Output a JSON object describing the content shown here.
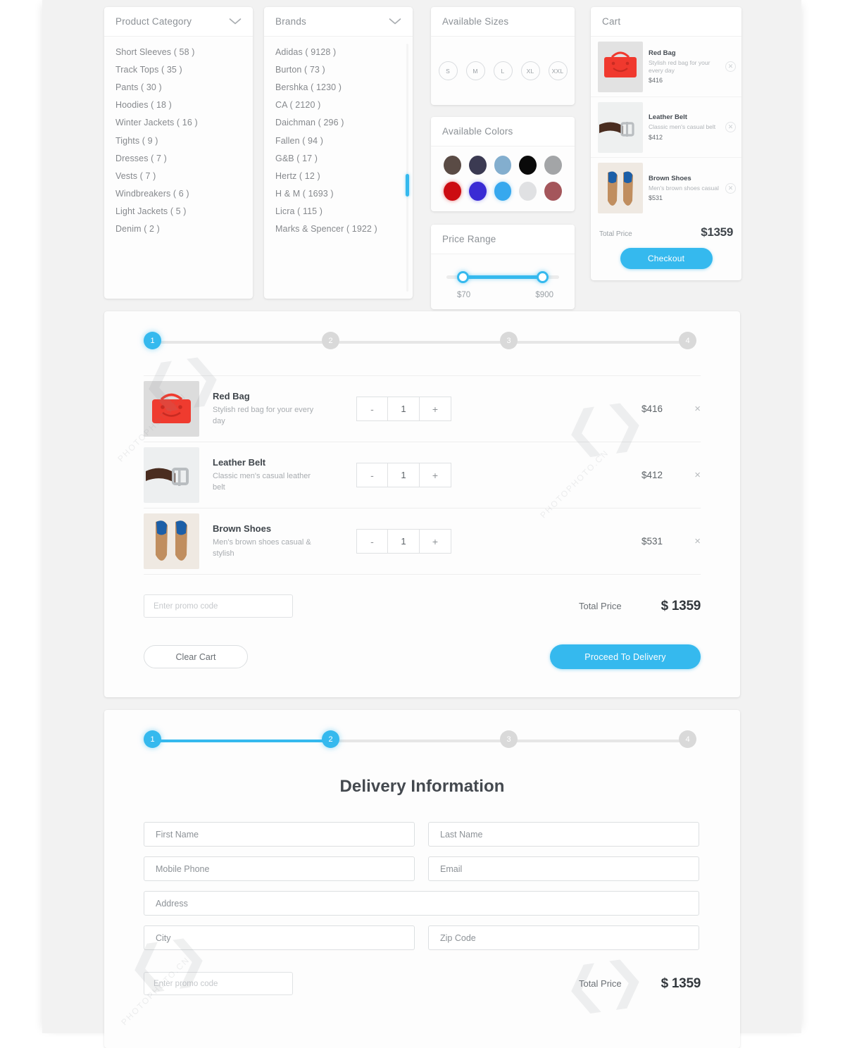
{
  "filters": {
    "product_category": {
      "title": "Product Category",
      "icon": "chevron-down-icon",
      "items": [
        "Short Sleeves ( 58 )",
        "Track Tops ( 35 )",
        "Pants ( 30 )",
        "Hoodies ( 18 )",
        "Winter Jackets ( 16 )",
        "Tights ( 9 )",
        "Dresses ( 7 )",
        "Vests ( 7 )",
        "Windbreakers ( 6 )",
        "Light Jackets ( 5 )",
        "Denim ( 2 )"
      ]
    },
    "brands": {
      "title": "Brands",
      "icon": "chevron-down-icon",
      "items": [
        "Adidas ( 9128 )",
        "Burton ( 73 )",
        "Bershka ( 1230 )",
        "CA ( 2120 )",
        "Daichman ( 296 )",
        "Fallen ( 94 )",
        "G&B ( 17 )",
        "Hertz ( 12 )",
        "H & M ( 1693 )",
        "Licra ( 115 )",
        "Marks & Spencer ( 1922 )"
      ]
    },
    "available_sizes": {
      "title": "Available Sizes",
      "sizes": [
        "S",
        "M",
        "L",
        "XL",
        "XXL"
      ]
    },
    "available_colors": {
      "title": "Available Colors",
      "row1": [
        "#5a4b45",
        "#3b3a52",
        "#83aece",
        "#0a0a0a",
        "#a3a5a7"
      ],
      "row2": [
        "#cc0c12",
        "#3a2bd4",
        "#37a8ee",
        "#e0e1e3",
        "#a4565b"
      ]
    },
    "price_range": {
      "title": "Price Range",
      "min_label": "$70",
      "max_label": "$900",
      "accent": "#35b9ee"
    }
  },
  "cart_panel": {
    "title": "Cart",
    "remove_icon": "circle-x-icon",
    "items": [
      {
        "name": "Red Bag",
        "desc": "Stylish red bag for your every day",
        "price": "$416"
      },
      {
        "name": "Leather Belt",
        "desc": "Classic men's casual belt",
        "price": "$412"
      },
      {
        "name": "Brown Shoes",
        "desc": "Men's brown shoes casual",
        "price": "$531"
      }
    ],
    "total_label": "Total Price",
    "total_value": "$1359",
    "checkout_label": "Checkout"
  },
  "cart_section": {
    "stepper": {
      "steps": [
        "1",
        "2",
        "3",
        "4"
      ],
      "active_index": 0,
      "active_color": "#35b9ee",
      "inactive_color": "#d9d9d9"
    },
    "columns": {
      "quantity_minus": "-",
      "quantity_plus": "+",
      "remove": "×"
    },
    "items": [
      {
        "name": "Red Bag",
        "desc": "Stylish red bag for your every day",
        "qty": "1",
        "price": "$416"
      },
      {
        "name": "Leather Belt",
        "desc": "Classic men's casual leather belt",
        "qty": "1",
        "price": "$412"
      },
      {
        "name": "Brown Shoes",
        "desc": "Men's brown shoes casual & stylish",
        "qty": "1",
        "price": "$531"
      }
    ],
    "promo_placeholder": "Enter promo code",
    "total_label": "Total Price",
    "total_value": "$ 1359",
    "clear_label": "Clear Cart",
    "proceed_label": "Proceed To Delivery"
  },
  "delivery_section": {
    "stepper": {
      "steps": [
        "1",
        "2",
        "3",
        "4"
      ],
      "active_index": 1,
      "active_color": "#35b9ee",
      "inactive_color": "#d9d9d9"
    },
    "title": "Delivery Information",
    "fields": {
      "first_name": "First Name",
      "last_name": "Last Name",
      "mobile_phone": "Mobile Phone",
      "email": "Email",
      "address": "Address",
      "city": "City",
      "zip_code": "Zip Code"
    },
    "promo_placeholder": "Enter promo code",
    "total_label": "Total Price",
    "total_value": "$ 1359"
  },
  "watermark": {
    "text": "PHOTOPHOTO.CN"
  }
}
